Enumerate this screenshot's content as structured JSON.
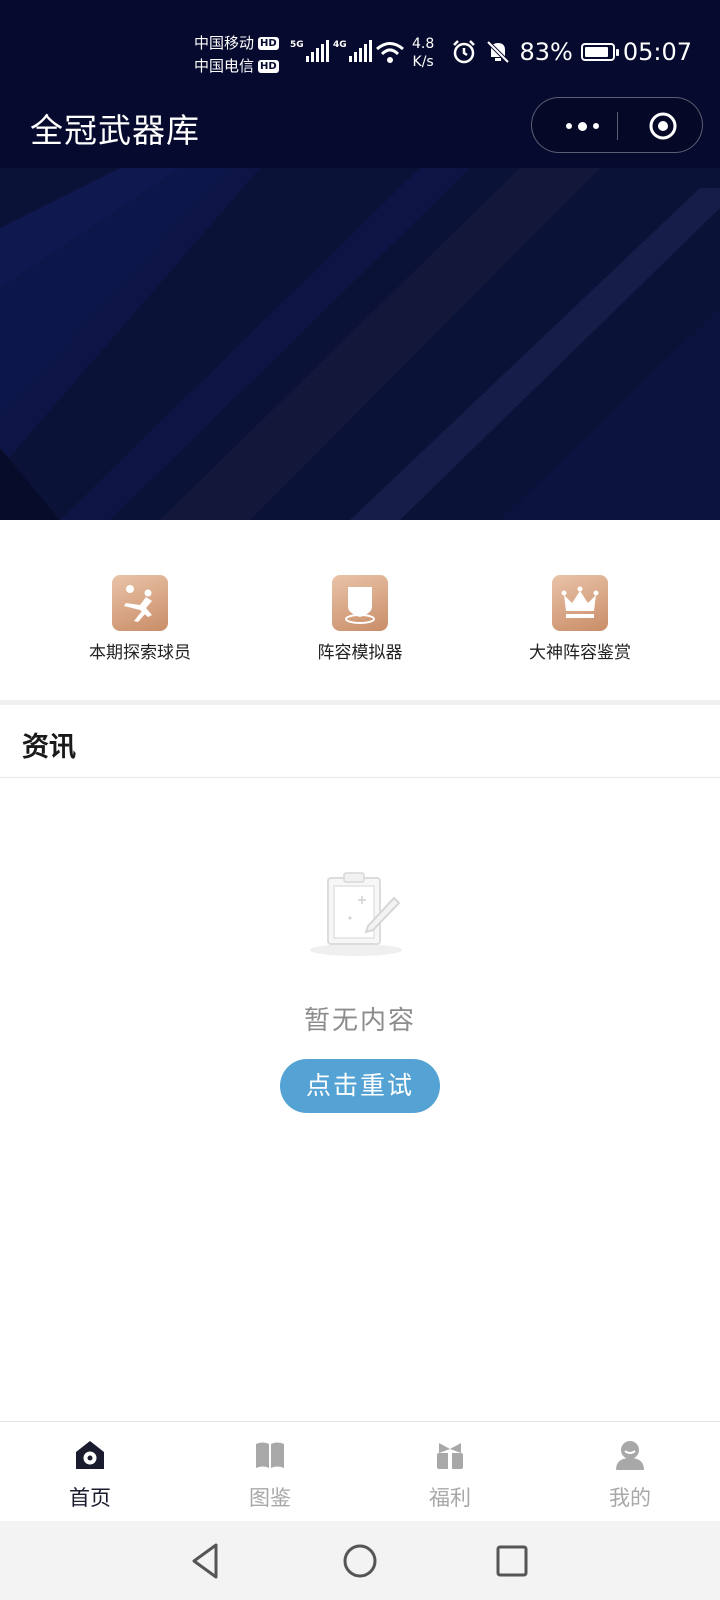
{
  "status_bar": {
    "carrier_1": "中国移动",
    "carrier_2": "中国电信",
    "hd_badge": "HD",
    "sim1_network": "5G",
    "sim2_network": "4G",
    "speed_value": "4.8",
    "speed_unit": "K/s",
    "battery_percent": "83%",
    "time": "05:07",
    "icons": [
      "alarm-icon",
      "mute-bell-icon",
      "wifi-icon",
      "battery-icon"
    ]
  },
  "header": {
    "title": "全冠武器库",
    "capsule_icons": [
      "more-dots-icon",
      "close-target-icon"
    ]
  },
  "quick_entries": [
    {
      "label": "本期探索球员",
      "icon": "kicking-player-icon"
    },
    {
      "label": "阵容模拟器",
      "icon": "shield-formation-icon"
    },
    {
      "label": "大神阵容鉴赏",
      "icon": "crown-icon"
    }
  ],
  "news": {
    "title": "资讯",
    "empty_text": "暂无内容",
    "retry_label": "点击重试"
  },
  "tabbar": {
    "tabs": [
      {
        "label": "首页",
        "icon": "home-ball-icon",
        "active": true
      },
      {
        "label": "图鉴",
        "icon": "book-icon",
        "active": false
      },
      {
        "label": "福利",
        "icon": "gift-icon",
        "active": false
      },
      {
        "label": "我的",
        "icon": "profile-icon",
        "active": false
      }
    ]
  },
  "colors": {
    "header_bg": "#060a2e",
    "banner_bg": "#0a1340",
    "entry_icon_gradient": [
      "#e9c3a8",
      "#c98d68"
    ],
    "retry_button": "#55a3d4",
    "tab_active": "#1b1b2f",
    "tab_inactive": "#a8a8a8"
  }
}
